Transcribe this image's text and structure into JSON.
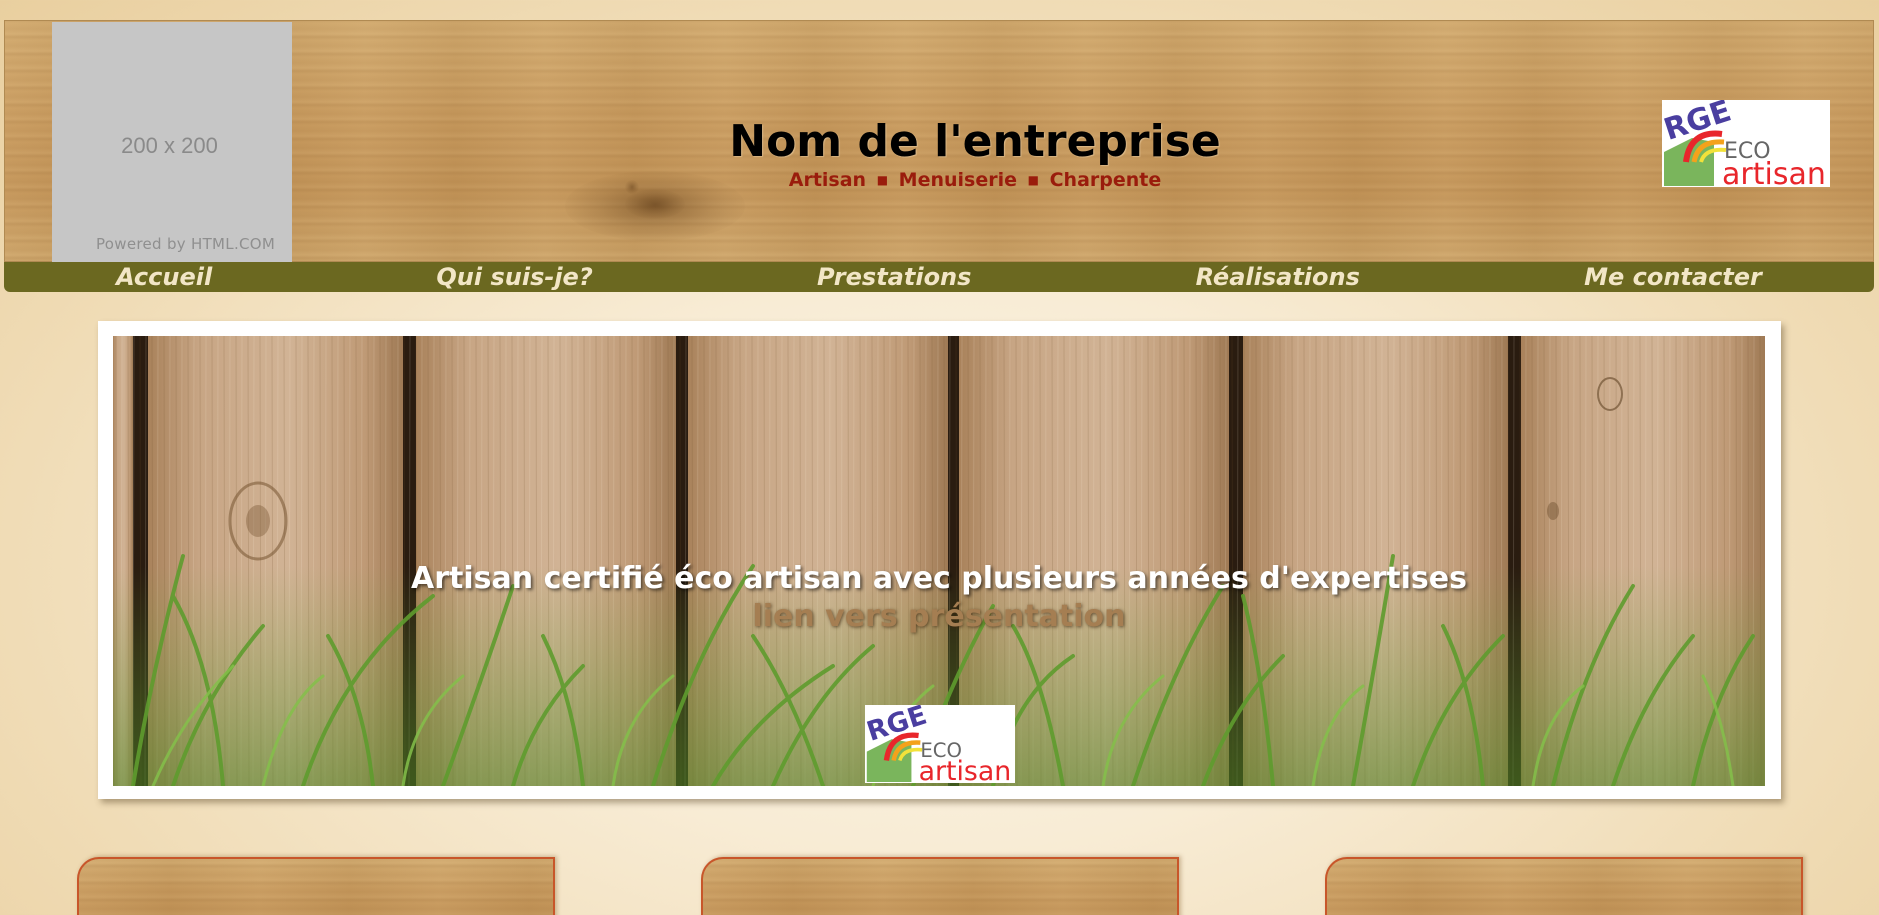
{
  "header": {
    "placeholder": {
      "size_label": "200 x 200",
      "powered_label": "Powered by HTML.COM"
    },
    "company_name": "Nom de l'entreprise",
    "tagline": {
      "items": [
        "Artisan",
        "Menuiserie",
        "Charpente"
      ],
      "separator": "■"
    },
    "badge": {
      "rge": "RGE",
      "eco": "ECO",
      "artisan": "artisan"
    }
  },
  "nav": {
    "items": [
      {
        "label": "Accueil"
      },
      {
        "label": "Qui suis-je?"
      },
      {
        "label": "Prestations"
      },
      {
        "label": "Réalisations"
      },
      {
        "label": "Me contacter"
      }
    ]
  },
  "hero": {
    "title": "Artisan certifié éco artisan avec plusieurs années d'expertises",
    "link_label": "lien vers présentation"
  },
  "icons": {
    "nav_separator": "square-bullet-icon",
    "badge": "rge-eco-artisan-logo"
  },
  "colors": {
    "nav_background": "#6b6820",
    "nav_text": "#f2e6c6",
    "tagline": "#9a1c0c",
    "hero_link": "#a57e52",
    "card_border": "#c8562a",
    "logo_red": "#e8262b",
    "logo_purple": "#4a3ea0",
    "logo_green": "#7ab55c"
  }
}
